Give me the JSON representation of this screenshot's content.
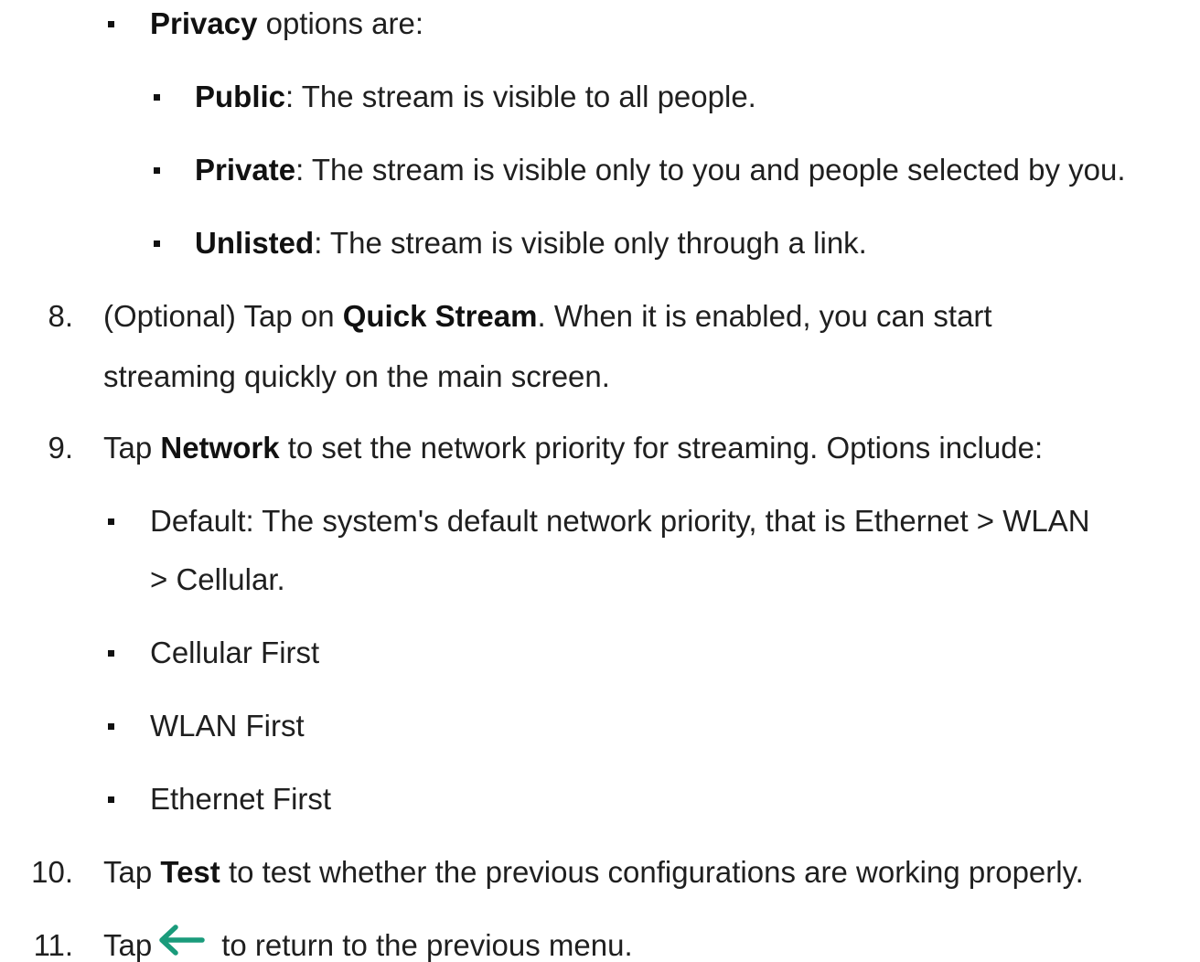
{
  "privacy": {
    "label": "Privacy",
    "rest": " options are:",
    "options": [
      {
        "label": "Public",
        "desc": ": The stream is visible to all people."
      },
      {
        "label": "Private",
        "desc": ": The stream is visible only to you and people selected by you."
      },
      {
        "label": "Unlisted",
        "desc": ": The stream is visible only through a link."
      }
    ]
  },
  "steps": [
    {
      "number": "8.",
      "prefix": "(Optional) Tap on ",
      "bold": "Quick Stream",
      "suffix": ". When it is enabled, you can start",
      "line2": "streaming quickly on the main screen."
    },
    {
      "number": "9.",
      "prefix": "Tap ",
      "bold": "Network",
      "suffix": " to set the network priority for streaming. Options include:"
    },
    {
      "number": "10.",
      "prefix": "Tap ",
      "bold": "Test",
      "suffix": " to test whether the previous configurations are working properly."
    },
    {
      "number": "11.",
      "prefix": "Tap",
      "icon": "back-arrow-icon",
      "suffix": "to return to the previous menu."
    }
  ],
  "network_options": {
    "default_line1": "Default: The system's default network priority, that is Ethernet > WLAN",
    "default_line2": "> Cellular.",
    "items": [
      "Cellular First",
      "WLAN First",
      "Ethernet First"
    ]
  },
  "colors": {
    "icon_accent": "#1a9b7b"
  }
}
